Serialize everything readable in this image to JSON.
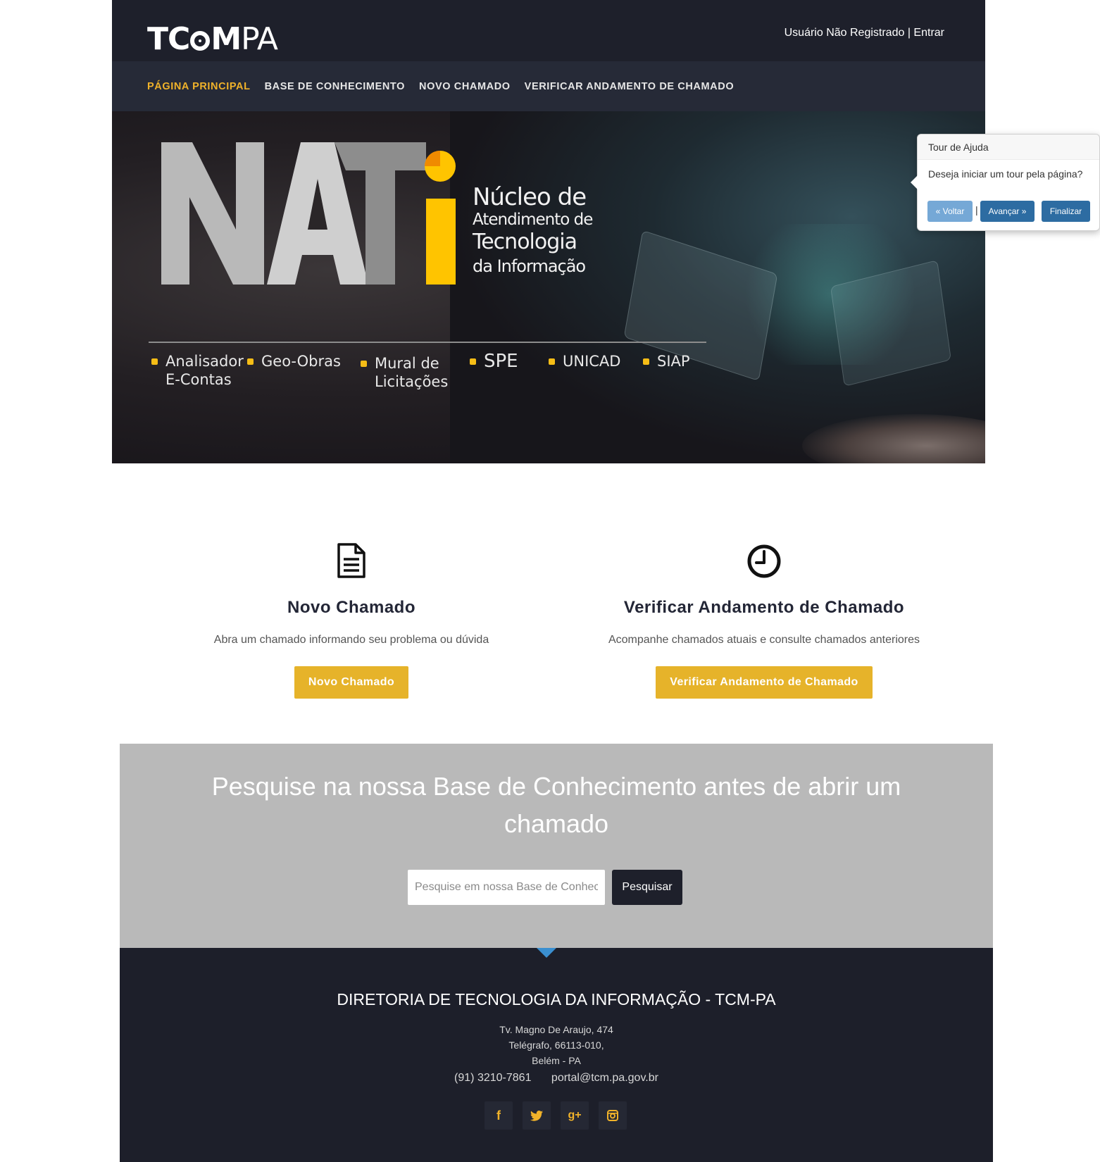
{
  "header": {
    "logo": {
      "bold": "TC",
      "mid": "M",
      "light": "PA"
    },
    "user_status": "Usuário Não Registrado",
    "separator": " | ",
    "login_link": "Entrar"
  },
  "nav": {
    "items": [
      {
        "label": "PÁGINA PRINCIPAL",
        "active": true
      },
      {
        "label": "BASE DE CONHECIMENTO",
        "active": false
      },
      {
        "label": "NOVO CHAMADO",
        "active": false
      },
      {
        "label": "VERIFICAR ANDAMENTO DE CHAMADO",
        "active": false
      }
    ],
    "active_color": "#f0b22a"
  },
  "hero": {
    "logo_text": "NATi",
    "lines": [
      "Núcleo de",
      "Atendimento de",
      "Tecnologia",
      "da Informação"
    ],
    "systems": [
      {
        "line1": "Analisador",
        "line2": "E-Contas"
      },
      {
        "line1": "Geo-Obras",
        "line2": ""
      },
      {
        "line1": "Mural de",
        "line2": "Licitações"
      },
      {
        "line1": "SPE",
        "line2": ""
      },
      {
        "line1": "UNICAD",
        "line2": ""
      },
      {
        "line1": "SIAP",
        "line2": ""
      }
    ]
  },
  "tour": {
    "title": "Tour de Ajuda",
    "content": "Deseja iniciar um tour pela página?",
    "prev_label": "« Voltar",
    "separator": "|",
    "next_label": "Avançar »",
    "end_label": "Finalizar"
  },
  "features": {
    "new_ticket": {
      "icon": "document-icon",
      "title": "Novo Chamado",
      "description": "Abra um chamado informando seu problema ou dúvida",
      "button": "Novo Chamado"
    },
    "check_ticket": {
      "icon": "clock-icon",
      "title": "Verificar Andamento de Chamado",
      "description": "Acompanhe chamados atuais e consulte chamados anteriores",
      "button": "Verificar Andamento de Chamado"
    },
    "button_color": "#e6b32a"
  },
  "search": {
    "title_line1": "Pesquise na nossa Base de Conhecimento antes de abrir um",
    "title_line2": "chamado",
    "placeholder": "Pesquise em nossa Base de Conhecimento",
    "button": "Pesquisar"
  },
  "footer": {
    "title": "DIRETORIA DE TECNOLOGIA DA INFORMAÇÃO - TCM-PA",
    "address": [
      "Tv. Magno De Araujo, 474",
      "Telégrafo, 66113-010,",
      "Belém - PA"
    ],
    "phone": "(91) 3210-7861",
    "email": "portal@tcm.pa.gov.br",
    "social": [
      {
        "icon": "facebook-icon",
        "glyph": "f"
      },
      {
        "icon": "twitter-icon",
        "glyph": "🐦"
      },
      {
        "icon": "google-plus-icon",
        "glyph": "g+"
      },
      {
        "icon": "instagram-icon",
        "glyph": "◙"
      }
    ]
  }
}
